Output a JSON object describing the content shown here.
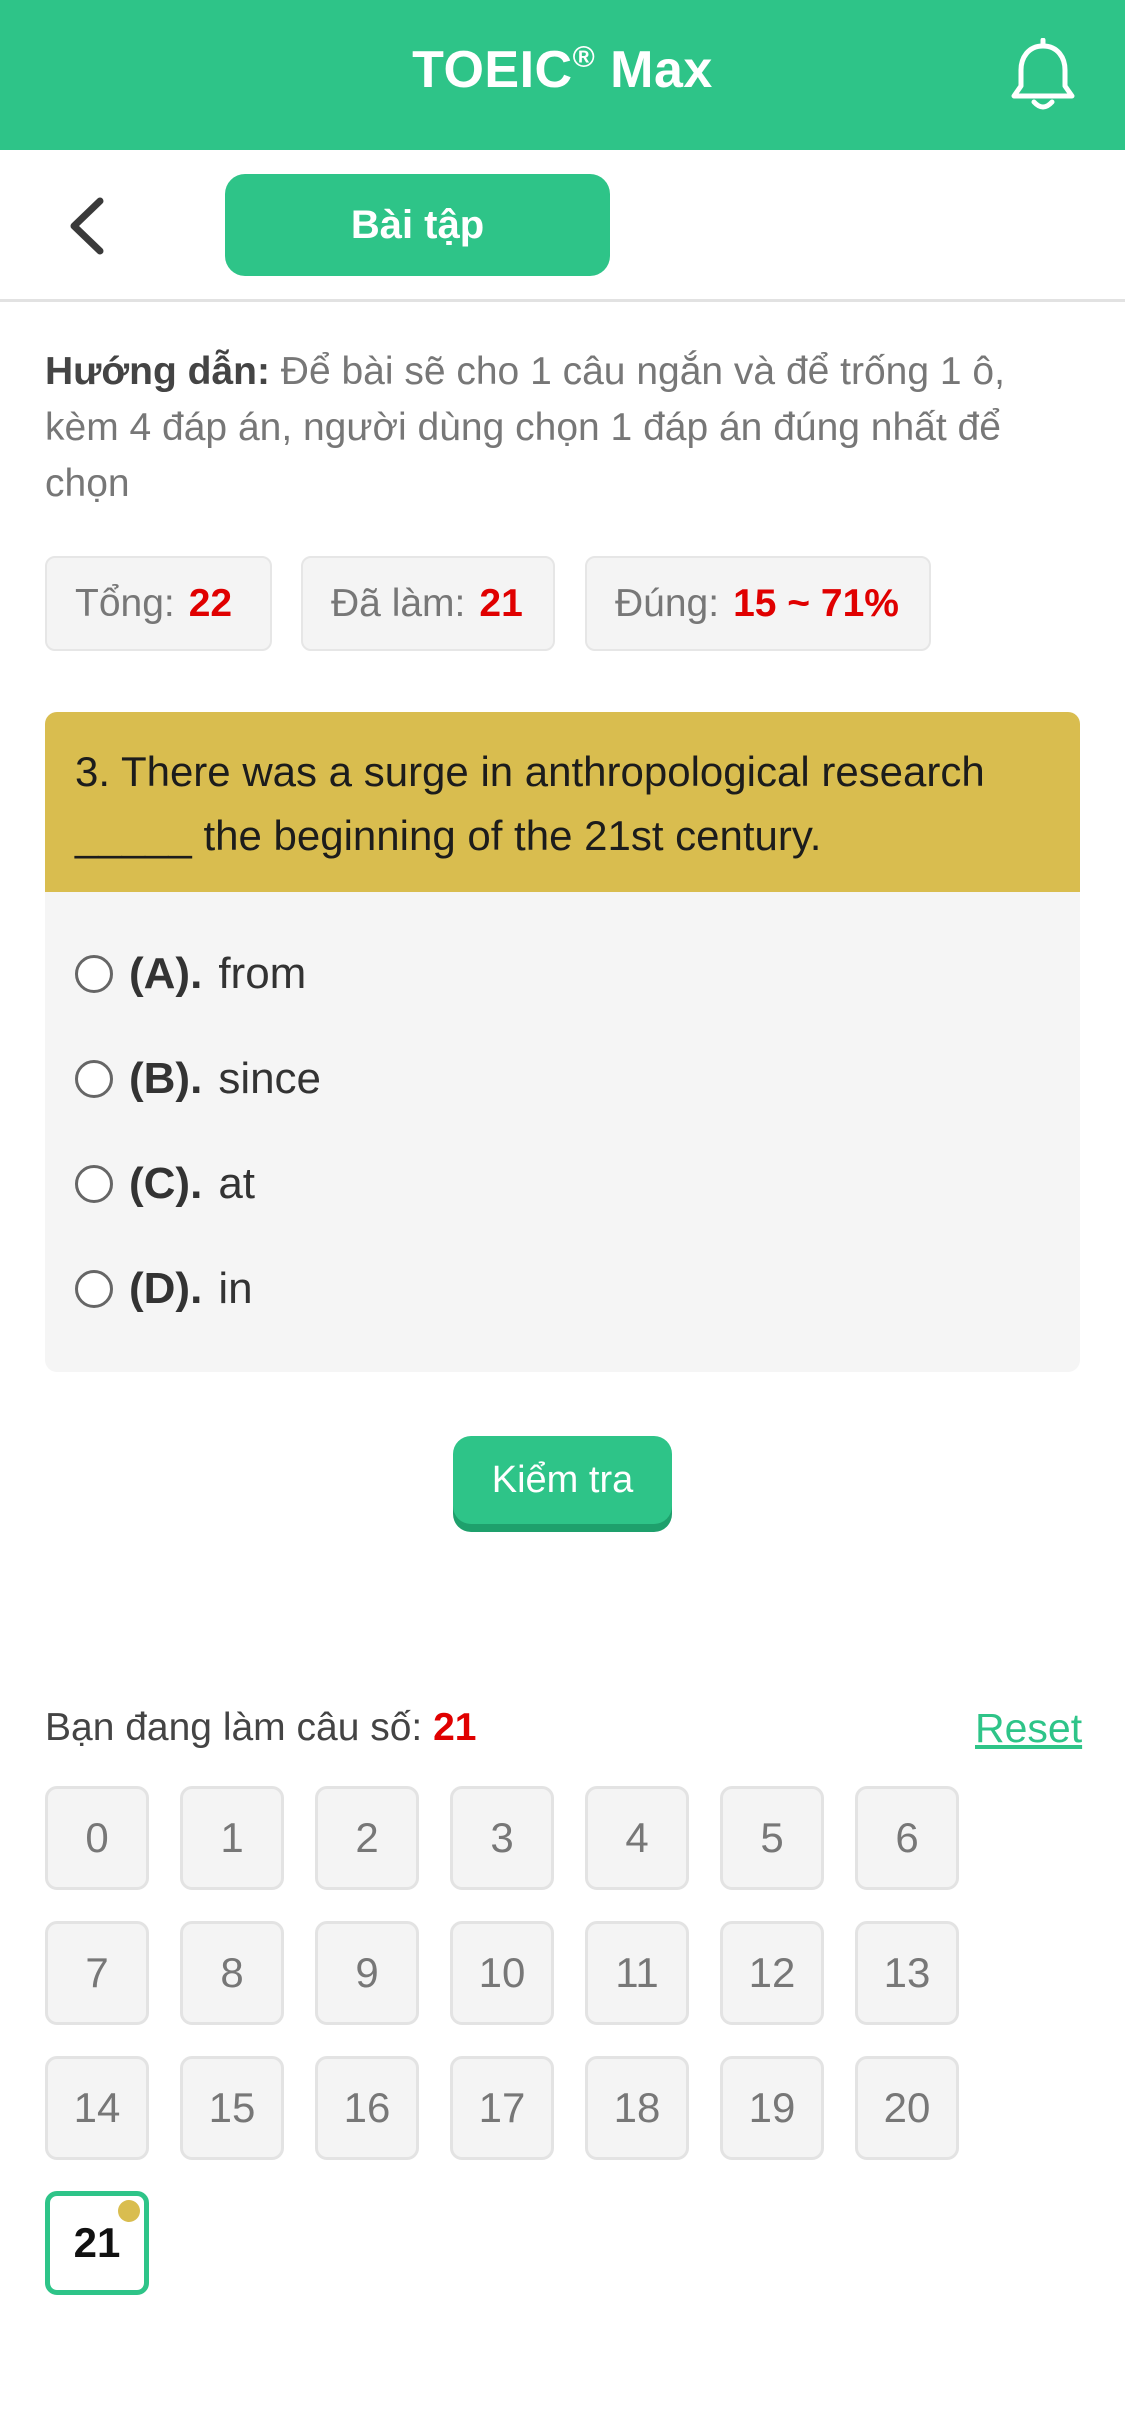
{
  "header": {
    "title": "TOEIC",
    "title_mark": "®",
    "title_suffix": " Max",
    "bell_icon": "bell-icon"
  },
  "nav": {
    "back_icon": "chevron-left-icon",
    "tab_label": "Bài tập"
  },
  "instruction": {
    "label": "Hướng dẫn:",
    "text": " Để bài sẽ cho 1 câu ngắn và để trống 1 ô, kèm 4 đáp án, người dùng chọn 1 đáp án đúng nhất để chọn"
  },
  "stats": {
    "total_label": "Tổng:",
    "total_value": "22",
    "done_label": "Đã làm:",
    "done_value": "21",
    "correct_label": "Đúng:",
    "correct_value": "15 ~ 71%"
  },
  "question": {
    "text": "3. There was a surge in anthropological research _____ the beginning of the 21st century.",
    "options": [
      {
        "letter": "(A).",
        "text": "from"
      },
      {
        "letter": "(B).",
        "text": "since"
      },
      {
        "letter": "(C).",
        "text": "at"
      },
      {
        "letter": "(D).",
        "text": "in"
      }
    ]
  },
  "check_button": "Kiểm tra",
  "progress": {
    "label": "Bạn đang làm câu số: ",
    "current": "21",
    "reset_label": "Reset"
  },
  "grid": [
    "0",
    "1",
    "2",
    "3",
    "4",
    "5",
    "6",
    "7",
    "8",
    "9",
    "10",
    "11",
    "12",
    "13",
    "14",
    "15",
    "16",
    "17",
    "18",
    "19",
    "20",
    "21"
  ],
  "colors": {
    "primary": "#2ec488",
    "question_bg": "#d9bd4f",
    "accent_red": "#e00000"
  }
}
